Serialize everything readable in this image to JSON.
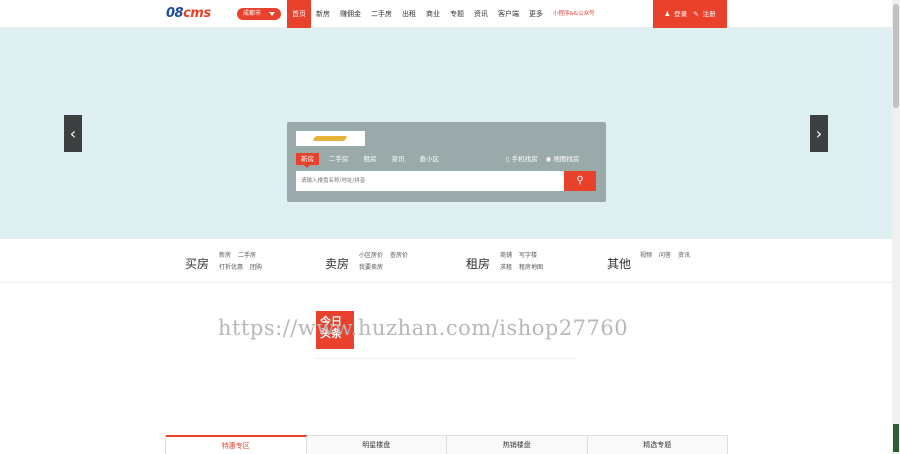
{
  "header": {
    "logo": "08cms",
    "city": "成都市",
    "nav": [
      "首页",
      "新房",
      "赚佣金",
      "二手房",
      "出租",
      "商业",
      "专题",
      "资讯",
      "客户端",
      "更多",
      "小程序&&公众号"
    ],
    "active_nav": "首页",
    "login": "登录",
    "register": "注册"
  },
  "search": {
    "tabs": [
      "新房",
      "二手房",
      "租房",
      "资讯",
      "查小区"
    ],
    "active_tab": "新房",
    "links": [
      "手机找房",
      "地图找房"
    ],
    "placeholder": "请输入楼盘名称/地址/拼音",
    "button_icon": "search-icon"
  },
  "categories": [
    {
      "title": "买房",
      "links": [
        "新房",
        "二手房",
        "打折优惠",
        "团购"
      ]
    },
    {
      "title": "卖房",
      "links": [
        "小区房价",
        "查房价",
        "我要卖房"
      ]
    },
    {
      "title": "租房",
      "links": [
        "商铺",
        "写字楼",
        "求租",
        "租房地图"
      ]
    },
    {
      "title": "其他",
      "links": [
        "视频",
        "问答",
        "资讯"
      ]
    }
  ],
  "headline": {
    "badge": "今日头条"
  },
  "watermark": "https://www.huzhan.com/ishop27760",
  "bottom_tabs": [
    "特惠专区",
    "明星楼盘",
    "热销楼盘",
    "精选专题"
  ],
  "colors": {
    "accent": "#e8412c",
    "banner_bg": "#dff0f2",
    "search_panel": "#9aa9a9",
    "logo_blue": "#1f4d9a"
  }
}
